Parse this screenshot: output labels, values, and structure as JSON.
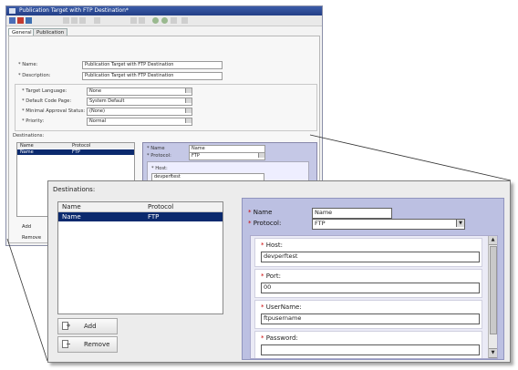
{
  "bg_window": {
    "title": "Publication Target with FTP Destination*",
    "tabs": [
      {
        "label": "General"
      },
      {
        "label": "Publication"
      }
    ],
    "fields": {
      "name_label": "* Name:",
      "name_value": "Publication Target with FTP Destination",
      "description_label": "* Description:",
      "description_value": "Publication Target with FTP Destination",
      "target_language_label": "* Target Language:",
      "target_language_value": "None",
      "default_code_page_label": "* Default Code Page:",
      "default_code_page_value": "System Default",
      "minimal_approval_status_label": "* Minimal Approval Status:",
      "minimal_approval_status_value": "(None)",
      "priority_label": "* Priority:",
      "priority_value": "Normal"
    },
    "destinations_label": "Destinations:",
    "list": {
      "headers": {
        "name": "Name",
        "protocol": "Protocol"
      },
      "row": {
        "name": "Name",
        "protocol": "FTP"
      }
    },
    "right": {
      "name_label": "* Name",
      "name_value": "Name",
      "protocol_label": "* Protocol:",
      "protocol_value": "FTP",
      "host_label": "* Host:",
      "host_value": "devperftest"
    },
    "add_label": "Add",
    "remove_label": "Remove"
  },
  "zoom": {
    "destinations_label": "Destinations:",
    "list": {
      "headers": {
        "name": "Name",
        "protocol": "Protocol"
      },
      "rows": [
        {
          "name": "Name",
          "protocol": "FTP"
        }
      ]
    },
    "add_label": "Add",
    "remove_label": "Remove",
    "right": {
      "name_label": "Name",
      "name_value": "Name",
      "protocol_label": "Protocol:",
      "protocol_value": "FTP",
      "host_label": "Host:",
      "host_value": "devperftest",
      "port_label": "Port:",
      "port_value": "00",
      "username_label": "UserName:",
      "username_value": "ftpusername",
      "password_label": "Password:",
      "required_mark": "*"
    }
  },
  "colors": {
    "title_bar": "#233e86",
    "selected_row": "#0b2a6e",
    "details_panel": "#bcc0e2",
    "required": "#cc0000"
  }
}
